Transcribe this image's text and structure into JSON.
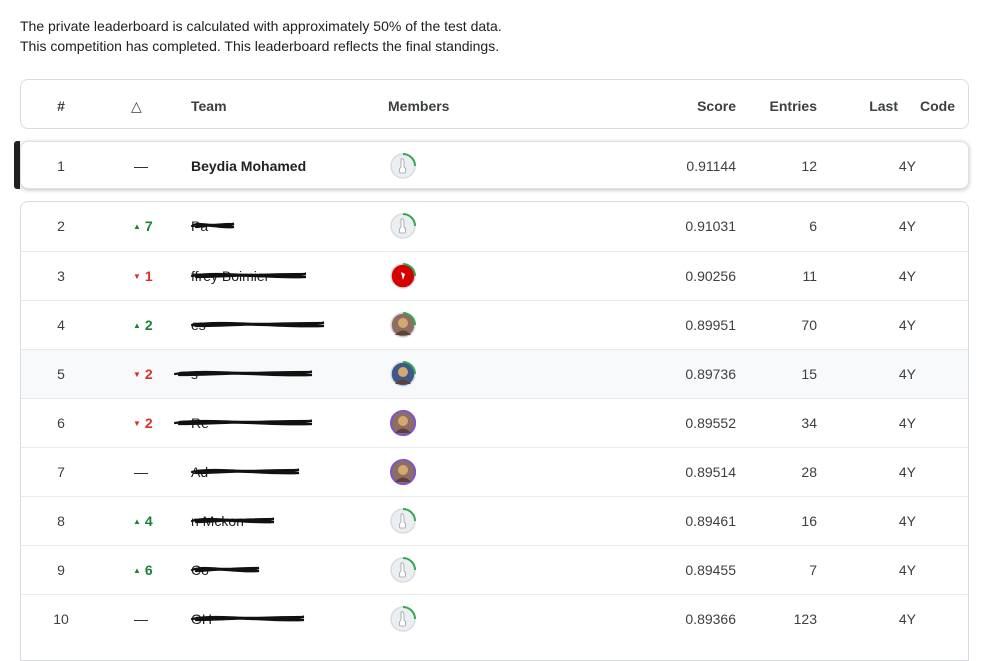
{
  "notice": {
    "line1": "The private leaderboard is calculated with approximately 50% of the test data.",
    "line2": "This competition has completed. This leaderboard reflects the final standings."
  },
  "columns": {
    "rank": "#",
    "delta": "△",
    "team": "Team",
    "members": "Members",
    "score": "Score",
    "entries": "Entries",
    "last": "Last",
    "code": "Code"
  },
  "self_row": {
    "rank": "1",
    "delta": "—",
    "team": "Beydia Mohamed",
    "score": "0.91144",
    "entries": "12",
    "last": "4Y",
    "avatar": "default-goose-avatar"
  },
  "rows": [
    {
      "rank": "2",
      "dir": "up",
      "delta": "7",
      "score": "0.91031",
      "entries": "6",
      "last": "4Y",
      "avatar": "default-goose-avatar"
    },
    {
      "rank": "3",
      "dir": "down",
      "delta": "1",
      "score": "0.90256",
      "entries": "11",
      "last": "4Y",
      "avatar": "red-photo-avatar"
    },
    {
      "rank": "4",
      "dir": "up",
      "delta": "2",
      "score": "0.89951",
      "entries": "70",
      "last": "4Y",
      "avatar": "photo-avatar"
    },
    {
      "rank": "5",
      "dir": "down",
      "delta": "2",
      "score": "0.89736",
      "entries": "15",
      "last": "4Y",
      "avatar": "photo-avatar"
    },
    {
      "rank": "6",
      "dir": "down",
      "delta": "2",
      "score": "0.89552",
      "entries": "34",
      "last": "4Y",
      "avatar": "photo-avatar"
    },
    {
      "rank": "7",
      "dir": "same",
      "delta": "—",
      "score": "0.89514",
      "entries": "28",
      "last": "4Y",
      "avatar": "photo-avatar"
    },
    {
      "rank": "8",
      "dir": "up",
      "delta": "4",
      "score": "0.89461",
      "entries": "16",
      "last": "4Y",
      "avatar": "default-goose-avatar"
    },
    {
      "rank": "9",
      "dir": "up",
      "delta": "6",
      "score": "0.89455",
      "entries": "7",
      "last": "4Y",
      "avatar": "default-goose-avatar"
    },
    {
      "rank": "10",
      "dir": "same",
      "delta": "—",
      "score": "0.89366",
      "entries": "123",
      "last": "4Y",
      "avatar": "default-goose-avatar"
    }
  ],
  "team_names_visible_fragments": [
    "Pa",
    "ffrey Boimier",
    "es",
    "s",
    "Re",
    "Ad",
    "n Mckon",
    "Co",
    "GH"
  ],
  "colors": {
    "up": "#188038",
    "down": "#d93025",
    "green_ring": "#34a853",
    "purple_ring": "#7e57c2"
  }
}
